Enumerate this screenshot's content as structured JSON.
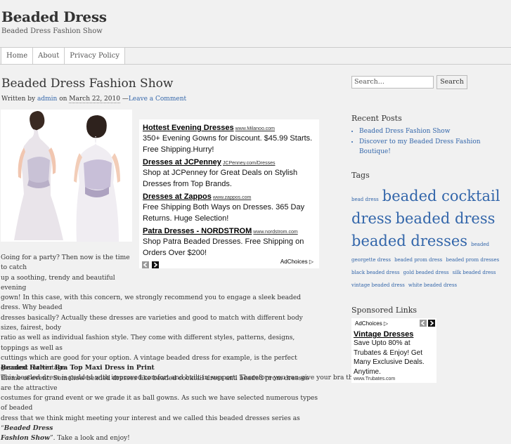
{
  "site": {
    "title": "Beaded Dress",
    "description": "Beaded Dress Fashion Show"
  },
  "nav": {
    "items": [
      "Home",
      "About",
      "Privacy Policy"
    ]
  },
  "post": {
    "title": "Beaded Dress Fashion Show",
    "meta_prefix": "Written by",
    "author": "admin",
    "on": "on",
    "date": "March 22, 2010",
    "dash": "—",
    "comment_link": "Leave a Comment",
    "body_lines": [
      "Going for a party? Then now is the time to catch",
      "up a soothing, trendy and beautiful evening",
      "gown! In this case, with this concern, we strongly recommend you to engage a sleek beaded dress. Why beaded",
      "dresses basically? Actually these dresses are varieties and good to match with different body sizes, fairest, body",
      "ratio as well as individual fashion style. They come with different styles, patterns, designs, toppings as well as",
      "cuttings which are good for your option. A vintage beaded dress for example, is the perfect garment for vintage",
      "theme of event. Somehow beaded dresses like beaded cocktail dress and beaded prom dresses are the attractive",
      "costumes for grand event or we grade it as ball gowns. As such we have selected numerous types of beaded",
      "dress that we think might meeting your interest and we called this beaded dresses series as “"
    ],
    "body_emph": "Beaded Dress",
    "body_emph2": "Fashion Show",
    "body_end": "”. Take a look and enjoy!",
    "subheading": "Beaded Halter Bra Top Maxi Dress in Print",
    "subtext": "This beaded dress is padded with improved comfort and built-in support. Therefore you can give your bra the"
  },
  "ads": [
    {
      "headline": "Hottest Evening Dresses",
      "url": "www.Milanoo.com",
      "text": "350+ Evening Gowns for Discount. $45.99 Starts. Free Shipping.Hurry!"
    },
    {
      "headline": "Dresses at JCPenney",
      "url": "JCPenney.com/Dresses",
      "text": "Shop at JCPenney for Great Deals on Stylish Dresses from Top Brands."
    },
    {
      "headline": "Dresses at Zappos",
      "url": "www.zappos.com",
      "text": "Free Shipping Both Ways on Dresses. 365 Day Returns. Huge Selection!"
    },
    {
      "headline": "Patra Dresses - NORDSTROM",
      "url": "www.nordstrom.com",
      "text": "Shop Patra Beaded Dresses. Free Shipping on Orders Over $200!"
    }
  ],
  "adchoices": "AdChoices",
  "sidebar": {
    "search_placeholder": "Search...",
    "search_button": "Search",
    "recent_title": "Recent Posts",
    "recent_posts": [
      "Beaded Dress Fashion Show",
      "Discover to my Beaded Dress Fashion Boutique!"
    ],
    "tags_title": "Tags",
    "tags": [
      {
        "label": "bead dress",
        "size": 7
      },
      {
        "label": "beaded cocktail dress",
        "size": 21
      },
      {
        "label": "beaded dress",
        "size": 21
      },
      {
        "label": "beaded dresses",
        "size": 21
      },
      {
        "label": "beaded georgette dress",
        "size": 7
      },
      {
        "label": "beaded prom dress",
        "size": 7
      },
      {
        "label": "beaded prom dresses",
        "size": 7
      },
      {
        "label": "black beaded dress",
        "size": 7
      },
      {
        "label": "gold beaded dress",
        "size": 7
      },
      {
        "label": "silk beaded dress",
        "size": 7
      },
      {
        "label": "vintage beaded dress",
        "size": 7
      },
      {
        "label": "white beaded dress",
        "size": 7
      }
    ],
    "sponsored_title": "Sponsored Links",
    "sponsored": {
      "adchoices": "AdChoices",
      "headline": "Vintage Dresses",
      "text": "Save Upto 80% at Trubates & Enjoy! Get Many Exclusive Deals. Anytime.",
      "url": "www.Trubates.com"
    }
  },
  "colors": {
    "link": "#3366aa",
    "background": "#f1f1f1",
    "text": "#333333"
  }
}
